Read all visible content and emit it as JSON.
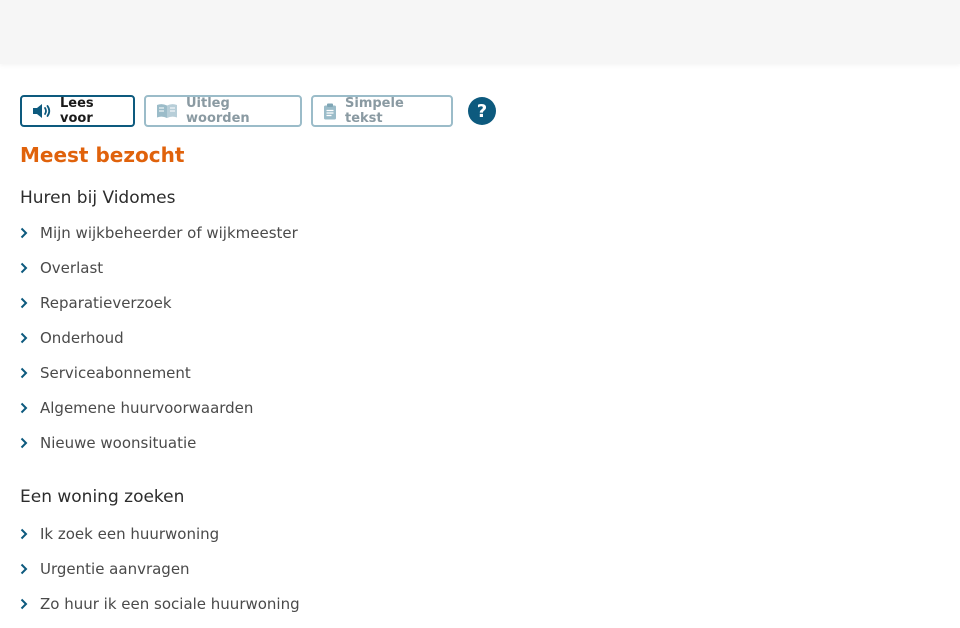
{
  "toolbar": {
    "read_aloud_label": "Lees voor",
    "explain_words_label": "Uitleg woorden",
    "simple_text_label": "Simpele tekst",
    "help_label": "?"
  },
  "colors": {
    "accent_orange": "#e0620b",
    "brand_blue": "#0d5a7e",
    "muted_border": "#9bbcc9",
    "chevron_blue": "#0d5a7e"
  },
  "section": {
    "title": "Meest bezocht"
  },
  "groups": [
    {
      "title": "Huren bij Vidomes",
      "links": [
        "Mijn wijkbeheerder of wijkmeester",
        "Overlast",
        "Reparatieverzoek",
        "Onderhoud",
        "Serviceabonnement",
        "Algemene huurvoorwaarden",
        "Nieuwe woonsituatie"
      ]
    },
    {
      "title": "Een woning zoeken",
      "links": [
        "Ik zoek een huurwoning",
        "Urgentie aanvragen",
        "Zo huur ik een sociale huurwoning"
      ]
    }
  ]
}
